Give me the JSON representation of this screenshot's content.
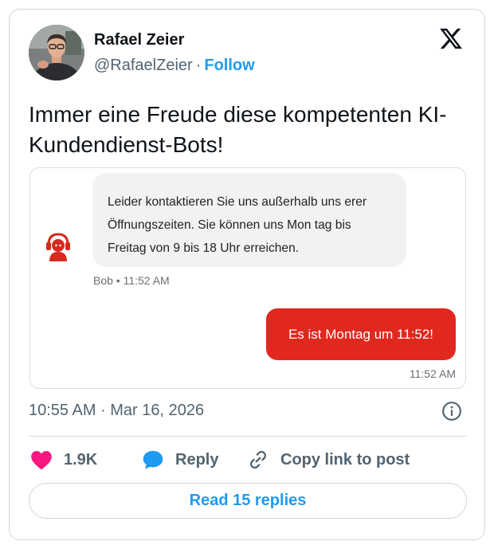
{
  "author": {
    "name": "Rafael Zeier",
    "handle": "@RafaelZeier",
    "separator": "·",
    "follow_label": "Follow"
  },
  "tweet": {
    "text": "Immer eine Freude diese kompetenten KI-Kundendienst-Bots!",
    "timestamp": "10:55 AM · Mar 16, 2026"
  },
  "chat": {
    "bot_message": "Leider kontaktieren Sie uns außerhalb uns erer Öffnungszeiten. Sie können uns Mon tag bis Freitag von 9 bis 18 Uhr erreichen.",
    "bot_meta": "Bob • 11:52 AM",
    "user_message": "Es ist Montag um 11:52!",
    "user_meta": "11:52 AM",
    "user_bubble_color": "#e0281f",
    "bot_icon": "headset-bot-icon"
  },
  "actions": {
    "likes": "1.9K",
    "reply_label": "Reply",
    "copy_label": "Copy link to post"
  },
  "read_replies_label": "Read 15 replies",
  "colors": {
    "accent": "#1d9bf0",
    "like": "#f91880",
    "text": "#0f1419",
    "muted": "#536471",
    "border": "#cfd9de"
  }
}
